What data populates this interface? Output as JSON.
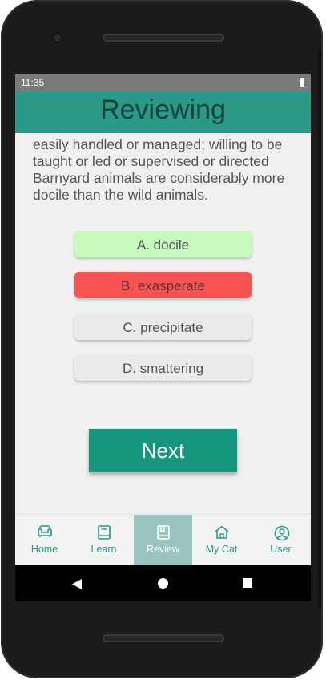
{
  "status_bar": {
    "time": "11:35"
  },
  "header": {
    "title": "Reviewing"
  },
  "question": {
    "definition_lines": [
      "easily handled or managed; willing to be",
      "taught or led or supervised or directed",
      "Barnyard animals are considerably more",
      "docile than the wild animals."
    ]
  },
  "choices": [
    {
      "label": "A. docile",
      "state": "correct",
      "color": "#c7fbbd"
    },
    {
      "label": "B. exasperate",
      "state": "wrong",
      "color": "#fb5252"
    },
    {
      "label": "C. precipitate",
      "state": "neutral",
      "color": "#ebebeb"
    },
    {
      "label": "D. smattering",
      "state": "neutral",
      "color": "#ebebeb"
    }
  ],
  "next_button": {
    "label": "Next",
    "color": "#16967d"
  },
  "bottom_nav": {
    "active": "Review",
    "items": [
      {
        "label": "Home",
        "icon": "sofa-icon"
      },
      {
        "label": "Learn",
        "icon": "book-icon"
      },
      {
        "label": "Review",
        "icon": "bookmark-book-icon"
      },
      {
        "label": "My Cat",
        "icon": "house-icon"
      },
      {
        "label": "User",
        "icon": "user-circle-icon"
      }
    ]
  },
  "colors": {
    "accent": "#2a9a88",
    "title_text": "#14413a",
    "nav_active_bg": "#9ac5bf"
  }
}
